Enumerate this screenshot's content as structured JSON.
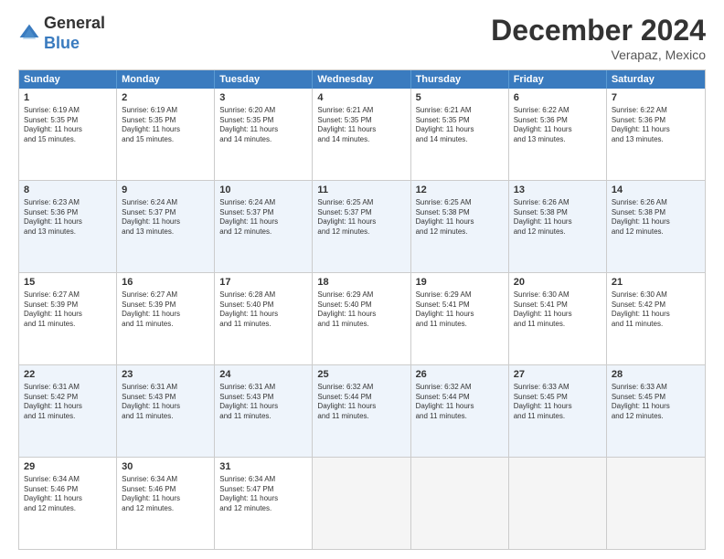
{
  "header": {
    "logo_line1": "General",
    "logo_line2": "Blue",
    "month": "December 2024",
    "location": "Verapaz, Mexico"
  },
  "weekdays": [
    "Sunday",
    "Monday",
    "Tuesday",
    "Wednesday",
    "Thursday",
    "Friday",
    "Saturday"
  ],
  "rows": [
    [
      {
        "day": "1",
        "lines": [
          "Sunrise: 6:19 AM",
          "Sunset: 5:35 PM",
          "Daylight: 11 hours",
          "and 15 minutes."
        ]
      },
      {
        "day": "2",
        "lines": [
          "Sunrise: 6:19 AM",
          "Sunset: 5:35 PM",
          "Daylight: 11 hours",
          "and 15 minutes."
        ]
      },
      {
        "day": "3",
        "lines": [
          "Sunrise: 6:20 AM",
          "Sunset: 5:35 PM",
          "Daylight: 11 hours",
          "and 14 minutes."
        ]
      },
      {
        "day": "4",
        "lines": [
          "Sunrise: 6:21 AM",
          "Sunset: 5:35 PM",
          "Daylight: 11 hours",
          "and 14 minutes."
        ]
      },
      {
        "day": "5",
        "lines": [
          "Sunrise: 6:21 AM",
          "Sunset: 5:35 PM",
          "Daylight: 11 hours",
          "and 14 minutes."
        ]
      },
      {
        "day": "6",
        "lines": [
          "Sunrise: 6:22 AM",
          "Sunset: 5:36 PM",
          "Daylight: 11 hours",
          "and 13 minutes."
        ]
      },
      {
        "day": "7",
        "lines": [
          "Sunrise: 6:22 AM",
          "Sunset: 5:36 PM",
          "Daylight: 11 hours",
          "and 13 minutes."
        ]
      }
    ],
    [
      {
        "day": "8",
        "lines": [
          "Sunrise: 6:23 AM",
          "Sunset: 5:36 PM",
          "Daylight: 11 hours",
          "and 13 minutes."
        ]
      },
      {
        "day": "9",
        "lines": [
          "Sunrise: 6:24 AM",
          "Sunset: 5:37 PM",
          "Daylight: 11 hours",
          "and 13 minutes."
        ]
      },
      {
        "day": "10",
        "lines": [
          "Sunrise: 6:24 AM",
          "Sunset: 5:37 PM",
          "Daylight: 11 hours",
          "and 12 minutes."
        ]
      },
      {
        "day": "11",
        "lines": [
          "Sunrise: 6:25 AM",
          "Sunset: 5:37 PM",
          "Daylight: 11 hours",
          "and 12 minutes."
        ]
      },
      {
        "day": "12",
        "lines": [
          "Sunrise: 6:25 AM",
          "Sunset: 5:38 PM",
          "Daylight: 11 hours",
          "and 12 minutes."
        ]
      },
      {
        "day": "13",
        "lines": [
          "Sunrise: 6:26 AM",
          "Sunset: 5:38 PM",
          "Daylight: 11 hours",
          "and 12 minutes."
        ]
      },
      {
        "day": "14",
        "lines": [
          "Sunrise: 6:26 AM",
          "Sunset: 5:38 PM",
          "Daylight: 11 hours",
          "and 12 minutes."
        ]
      }
    ],
    [
      {
        "day": "15",
        "lines": [
          "Sunrise: 6:27 AM",
          "Sunset: 5:39 PM",
          "Daylight: 11 hours",
          "and 11 minutes."
        ]
      },
      {
        "day": "16",
        "lines": [
          "Sunrise: 6:27 AM",
          "Sunset: 5:39 PM",
          "Daylight: 11 hours",
          "and 11 minutes."
        ]
      },
      {
        "day": "17",
        "lines": [
          "Sunrise: 6:28 AM",
          "Sunset: 5:40 PM",
          "Daylight: 11 hours",
          "and 11 minutes."
        ]
      },
      {
        "day": "18",
        "lines": [
          "Sunrise: 6:29 AM",
          "Sunset: 5:40 PM",
          "Daylight: 11 hours",
          "and 11 minutes."
        ]
      },
      {
        "day": "19",
        "lines": [
          "Sunrise: 6:29 AM",
          "Sunset: 5:41 PM",
          "Daylight: 11 hours",
          "and 11 minutes."
        ]
      },
      {
        "day": "20",
        "lines": [
          "Sunrise: 6:30 AM",
          "Sunset: 5:41 PM",
          "Daylight: 11 hours",
          "and 11 minutes."
        ]
      },
      {
        "day": "21",
        "lines": [
          "Sunrise: 6:30 AM",
          "Sunset: 5:42 PM",
          "Daylight: 11 hours",
          "and 11 minutes."
        ]
      }
    ],
    [
      {
        "day": "22",
        "lines": [
          "Sunrise: 6:31 AM",
          "Sunset: 5:42 PM",
          "Daylight: 11 hours",
          "and 11 minutes."
        ]
      },
      {
        "day": "23",
        "lines": [
          "Sunrise: 6:31 AM",
          "Sunset: 5:43 PM",
          "Daylight: 11 hours",
          "and 11 minutes."
        ]
      },
      {
        "day": "24",
        "lines": [
          "Sunrise: 6:31 AM",
          "Sunset: 5:43 PM",
          "Daylight: 11 hours",
          "and 11 minutes."
        ]
      },
      {
        "day": "25",
        "lines": [
          "Sunrise: 6:32 AM",
          "Sunset: 5:44 PM",
          "Daylight: 11 hours",
          "and 11 minutes."
        ]
      },
      {
        "day": "26",
        "lines": [
          "Sunrise: 6:32 AM",
          "Sunset: 5:44 PM",
          "Daylight: 11 hours",
          "and 11 minutes."
        ]
      },
      {
        "day": "27",
        "lines": [
          "Sunrise: 6:33 AM",
          "Sunset: 5:45 PM",
          "Daylight: 11 hours",
          "and 11 minutes."
        ]
      },
      {
        "day": "28",
        "lines": [
          "Sunrise: 6:33 AM",
          "Sunset: 5:45 PM",
          "Daylight: 11 hours",
          "and 12 minutes."
        ]
      }
    ],
    [
      {
        "day": "29",
        "lines": [
          "Sunrise: 6:34 AM",
          "Sunset: 5:46 PM",
          "Daylight: 11 hours",
          "and 12 minutes."
        ]
      },
      {
        "day": "30",
        "lines": [
          "Sunrise: 6:34 AM",
          "Sunset: 5:46 PM",
          "Daylight: 11 hours",
          "and 12 minutes."
        ]
      },
      {
        "day": "31",
        "lines": [
          "Sunrise: 6:34 AM",
          "Sunset: 5:47 PM",
          "Daylight: 11 hours",
          "and 12 minutes."
        ]
      },
      null,
      null,
      null,
      null
    ]
  ]
}
